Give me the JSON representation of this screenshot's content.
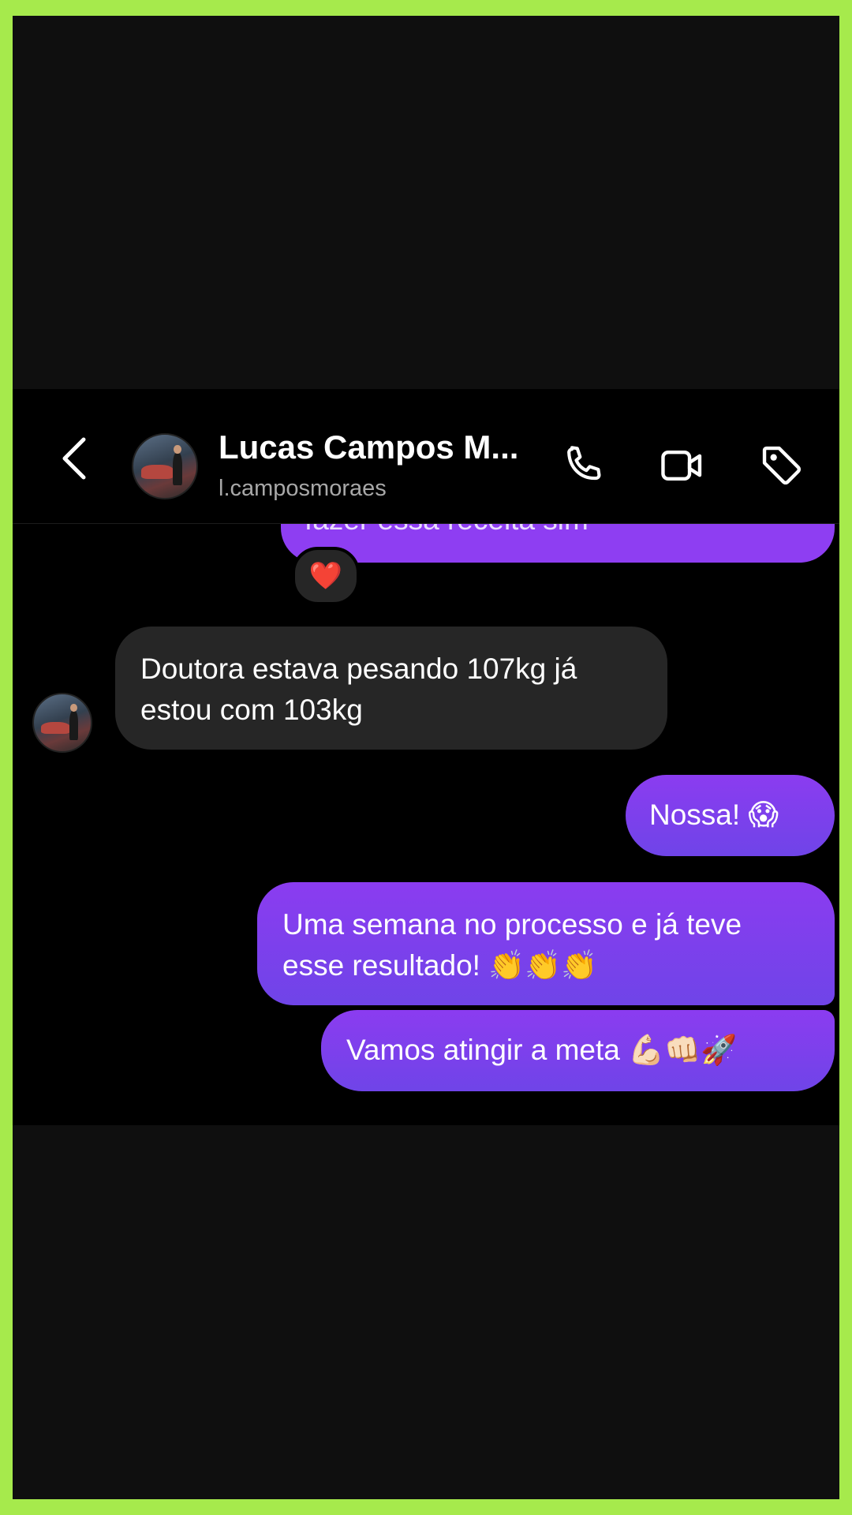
{
  "header": {
    "back_icon": "chevron-left-icon",
    "contact_name": "Lucas Campos M...",
    "contact_handle": "l.camposmoraes",
    "actions": [
      "phone-icon",
      "video-camera-icon",
      "tag-icon"
    ]
  },
  "messages": [
    {
      "direction": "sent",
      "text": "fazer essa receita sim",
      "reaction": "❤️"
    },
    {
      "direction": "received",
      "text": "Doutora estava pesando 107kg já estou com 103kg"
    },
    {
      "direction": "sent",
      "text": "Nossa! 😱"
    },
    {
      "direction": "sent",
      "text": "Uma semana no processo e já teve esse resultado! 👏👏👏"
    },
    {
      "direction": "sent",
      "text": "Vamos atingir a meta 💪🏻👊🏻🚀"
    }
  ],
  "colors": {
    "border": "#a6ea4c",
    "sent_bubble": "#8b3cf0",
    "received_bubble": "#262626",
    "background": "#000000"
  }
}
